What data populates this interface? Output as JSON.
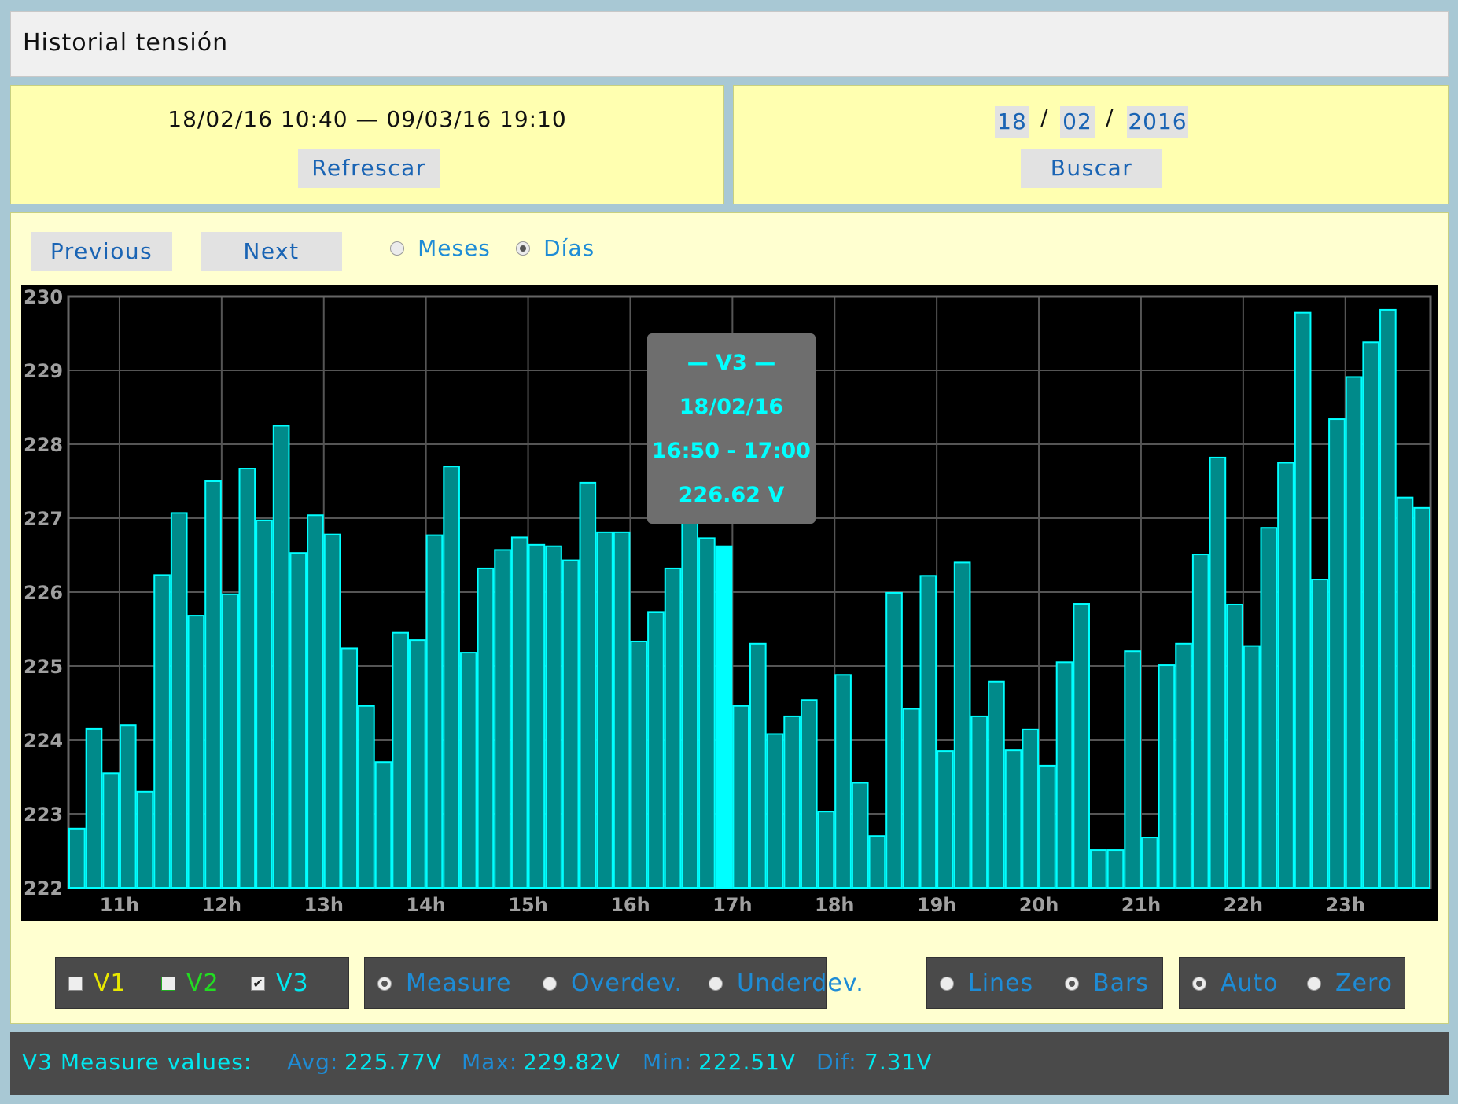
{
  "header": {
    "title": "Historial tensión"
  },
  "range": {
    "text": "18/02/16 10:40 — 09/03/16 19:10",
    "refresh_label": "Refrescar"
  },
  "date_search": {
    "day": "18",
    "month": "02",
    "year": "2016",
    "sep": "/",
    "search_label": "Buscar"
  },
  "nav": {
    "previous_label": "Previous",
    "next_label": "Next",
    "modes": [
      {
        "label": "Meses",
        "selected": false
      },
      {
        "label": "Días",
        "selected": true
      }
    ]
  },
  "chart_data": {
    "type": "bar",
    "series_name": "V3",
    "ylim": [
      222,
      230
    ],
    "y_ticks": [
      "230",
      "229",
      "228",
      "227",
      "226",
      "225",
      "224",
      "223",
      "222"
    ],
    "x_ticks": [
      "11h",
      "12h",
      "13h",
      "14h",
      "15h",
      "16h",
      "17h",
      "18h",
      "19h",
      "20h",
      "21h",
      "22h",
      "23h"
    ],
    "x_tick_slots": [
      3,
      9,
      15,
      21,
      27,
      33,
      39,
      45,
      51,
      57,
      63,
      69,
      75
    ],
    "first_slot_time": "10:40",
    "interval_minutes": 10,
    "values": [
      222.8,
      224.15,
      223.55,
      224.2,
      223.3,
      226.23,
      227.07,
      225.68,
      227.5,
      225.97,
      227.67,
      226.97,
      228.25,
      226.53,
      227.04,
      226.78,
      225.24,
      224.46,
      223.7,
      225.45,
      225.35,
      226.77,
      227.7,
      225.18,
      226.32,
      226.57,
      226.74,
      226.64,
      226.62,
      226.43,
      227.48,
      226.81,
      226.81,
      225.33,
      225.73,
      226.32,
      226.97,
      226.73,
      226.62,
      224.46,
      225.3,
      224.08,
      224.32,
      224.54,
      223.03,
      224.88,
      223.42,
      222.7,
      225.99,
      224.42,
      226.22,
      223.85,
      226.4,
      224.32,
      224.79,
      223.86,
      224.14,
      223.65,
      225.05,
      225.84,
      222.51,
      222.51,
      225.2,
      222.68,
      225.01,
      225.3,
      226.51,
      227.82,
      225.83,
      225.27,
      226.87,
      227.75,
      229.78,
      226.17,
      228.34,
      228.91,
      229.38,
      229.82,
      227.28,
      227.14
    ],
    "highlight_index": 38,
    "bar_color": "#008a8a",
    "bar_edge": "#00ffff",
    "highlight_color": "#00ffff"
  },
  "tooltip": {
    "series": "— V3 —",
    "date": "18/02/16",
    "time": "16:50 - 17:00",
    "value": "226.62 V"
  },
  "controls": {
    "series": [
      {
        "label": "V1",
        "checked": false,
        "color": "#e8e800"
      },
      {
        "label": "V2",
        "checked": false,
        "color": "#22dd22"
      },
      {
        "label": "V3",
        "checked": true,
        "color": "#00e8f0"
      }
    ],
    "measure": [
      {
        "label": "Measure",
        "selected": true
      },
      {
        "label": "Overdev.",
        "selected": false
      },
      {
        "label": "Underdev.",
        "selected": false
      }
    ],
    "style": [
      {
        "label": "Lines",
        "selected": false
      },
      {
        "label": "Bars",
        "selected": true
      }
    ],
    "scale": [
      {
        "label": "Auto",
        "selected": true
      },
      {
        "label": "Zero",
        "selected": false
      }
    ]
  },
  "footer": {
    "title": "V3 Measure values:",
    "avg_label": "Avg:",
    "avg_value": "225.77V",
    "max_label": "Max:",
    "max_value": "229.82V",
    "min_label": "Min:",
    "min_value": "222.51V",
    "dif_label": "Dif:",
    "dif_value": "7.31V"
  }
}
